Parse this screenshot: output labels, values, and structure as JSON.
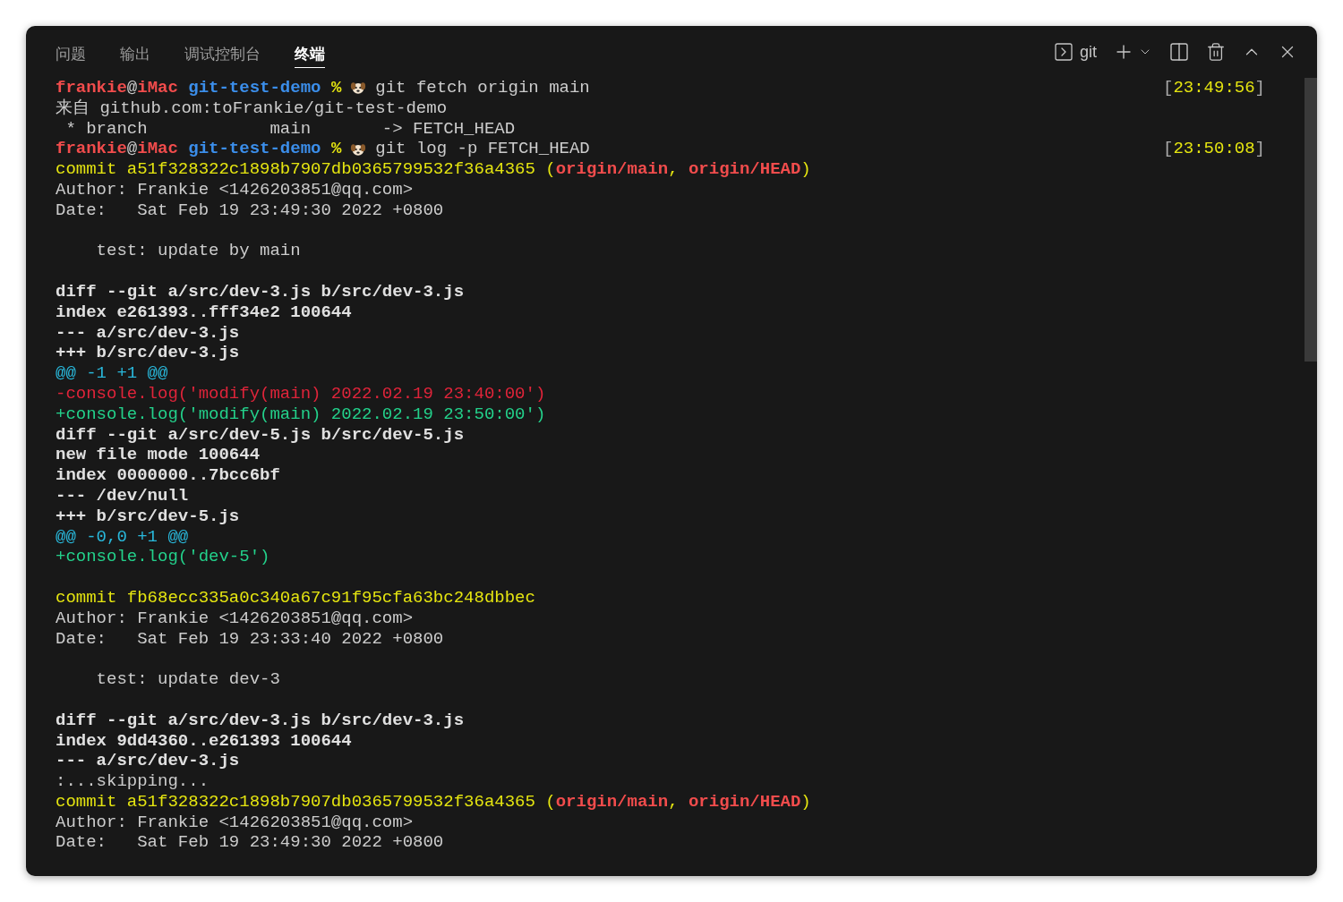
{
  "tabs": [
    {
      "label": "问题",
      "selected": false
    },
    {
      "label": "输出",
      "selected": false
    },
    {
      "label": "调试控制台",
      "selected": false
    },
    {
      "label": "终端",
      "selected": true
    }
  ],
  "toolbar": {
    "shell_label": "git"
  },
  "lines": [
    {
      "kind": "prompt",
      "user": "frankie",
      "at": "@",
      "host": "iMac",
      "dir": "git-test-demo",
      "symbol": "%",
      "command": "git fetch origin main",
      "time": {
        "open": "[",
        "value": "23:49:56",
        "close": "]"
      }
    },
    {
      "kind": "text",
      "segments": [
        {
          "kind": "plain",
          "text": "来自 github.com:toFrankie/git-test-demo"
        }
      ]
    },
    {
      "kind": "text",
      "segments": [
        {
          "kind": "plain",
          "text": " * branch            main       -> FETCH_HEAD"
        }
      ]
    },
    {
      "kind": "prompt",
      "user": "frankie",
      "at": "@",
      "host": "iMac",
      "dir": "git-test-demo",
      "symbol": "%",
      "command": "git log -p FETCH_HEAD",
      "time": {
        "open": "[",
        "value": "23:50:08",
        "close": "]"
      }
    },
    {
      "kind": "text",
      "segments": [
        {
          "kind": "commit",
          "text": "commit a51f328322c1898b7907db0365799532f36a4365 ("
        },
        {
          "kind": "ref",
          "text": "origin/main"
        },
        {
          "kind": "commit",
          "text": ", "
        },
        {
          "kind": "ref",
          "text": "origin/HEAD"
        },
        {
          "kind": "commit",
          "text": ")"
        }
      ]
    },
    {
      "kind": "text",
      "segments": [
        {
          "kind": "plain",
          "text": "Author: Frankie <1426203851@qq.com>"
        }
      ]
    },
    {
      "kind": "text",
      "segments": [
        {
          "kind": "plain",
          "text": "Date:   Sat Feb 19 23:49:30 2022 +0800"
        }
      ]
    },
    {
      "kind": "blank"
    },
    {
      "kind": "text",
      "segments": [
        {
          "kind": "plain",
          "text": "    test: update by main"
        }
      ]
    },
    {
      "kind": "blank"
    },
    {
      "kind": "text",
      "segments": [
        {
          "kind": "bold",
          "text": "diff --git a/src/dev-3.js b/src/dev-3.js"
        }
      ]
    },
    {
      "kind": "text",
      "segments": [
        {
          "kind": "bold",
          "text": "index e261393..fff34e2 100644"
        }
      ]
    },
    {
      "kind": "text",
      "segments": [
        {
          "kind": "bold",
          "text": "--- a/src/dev-3.js"
        }
      ]
    },
    {
      "kind": "text",
      "segments": [
        {
          "kind": "bold",
          "text": "+++ b/src/dev-3.js"
        }
      ]
    },
    {
      "kind": "text",
      "segments": [
        {
          "kind": "hunk",
          "text": "@@ -1 +1 @@"
        }
      ]
    },
    {
      "kind": "text",
      "segments": [
        {
          "kind": "del",
          "text": "-console.log('modify(main) 2022.02.19 23:40:00')"
        }
      ]
    },
    {
      "kind": "text",
      "segments": [
        {
          "kind": "add",
          "text": "+console.log('modify(main) 2022.02.19 23:50:00')"
        }
      ]
    },
    {
      "kind": "text",
      "segments": [
        {
          "kind": "bold",
          "text": "diff --git a/src/dev-5.js b/src/dev-5.js"
        }
      ]
    },
    {
      "kind": "text",
      "segments": [
        {
          "kind": "bold",
          "text": "new file mode 100644"
        }
      ]
    },
    {
      "kind": "text",
      "segments": [
        {
          "kind": "bold",
          "text": "index 0000000..7bcc6bf"
        }
      ]
    },
    {
      "kind": "text",
      "segments": [
        {
          "kind": "bold",
          "text": "--- /dev/null"
        }
      ]
    },
    {
      "kind": "text",
      "segments": [
        {
          "kind": "bold",
          "text": "+++ b/src/dev-5.js"
        }
      ]
    },
    {
      "kind": "text",
      "segments": [
        {
          "kind": "hunk",
          "text": "@@ -0,0 +1 @@"
        }
      ]
    },
    {
      "kind": "text",
      "segments": [
        {
          "kind": "add",
          "text": "+console.log('dev-5')"
        }
      ]
    },
    {
      "kind": "blank"
    },
    {
      "kind": "text",
      "segments": [
        {
          "kind": "commit",
          "text": "commit fb68ecc335a0c340a67c91f95cfa63bc248dbbec"
        }
      ]
    },
    {
      "kind": "text",
      "segments": [
        {
          "kind": "plain",
          "text": "Author: Frankie <1426203851@qq.com>"
        }
      ]
    },
    {
      "kind": "text",
      "segments": [
        {
          "kind": "plain",
          "text": "Date:   Sat Feb 19 23:33:40 2022 +0800"
        }
      ]
    },
    {
      "kind": "blank"
    },
    {
      "kind": "text",
      "segments": [
        {
          "kind": "plain",
          "text": "    test: update dev-3"
        }
      ]
    },
    {
      "kind": "blank"
    },
    {
      "kind": "text",
      "segments": [
        {
          "kind": "bold",
          "text": "diff --git a/src/dev-3.js b/src/dev-3.js"
        }
      ]
    },
    {
      "kind": "text",
      "segments": [
        {
          "kind": "bold",
          "text": "index 9dd4360..e261393 100644"
        }
      ]
    },
    {
      "kind": "text",
      "segments": [
        {
          "kind": "bold",
          "text": "--- a/src/dev-3.js"
        }
      ]
    },
    {
      "kind": "text",
      "segments": [
        {
          "kind": "plain",
          "text": ":...skipping..."
        }
      ]
    },
    {
      "kind": "text",
      "segments": [
        {
          "kind": "commit",
          "text": "commit a51f328322c1898b7907db0365799532f36a4365 ("
        },
        {
          "kind": "ref",
          "text": "origin/main"
        },
        {
          "kind": "commit",
          "text": ", "
        },
        {
          "kind": "ref",
          "text": "origin/HEAD"
        },
        {
          "kind": "commit",
          "text": ")"
        }
      ]
    },
    {
      "kind": "text",
      "segments": [
        {
          "kind": "plain",
          "text": "Author: Frankie <1426203851@qq.com>"
        }
      ]
    },
    {
      "kind": "text",
      "segments": [
        {
          "kind": "plain",
          "text": "Date:   Sat Feb 19 23:49:30 2022 +0800"
        }
      ]
    }
  ]
}
